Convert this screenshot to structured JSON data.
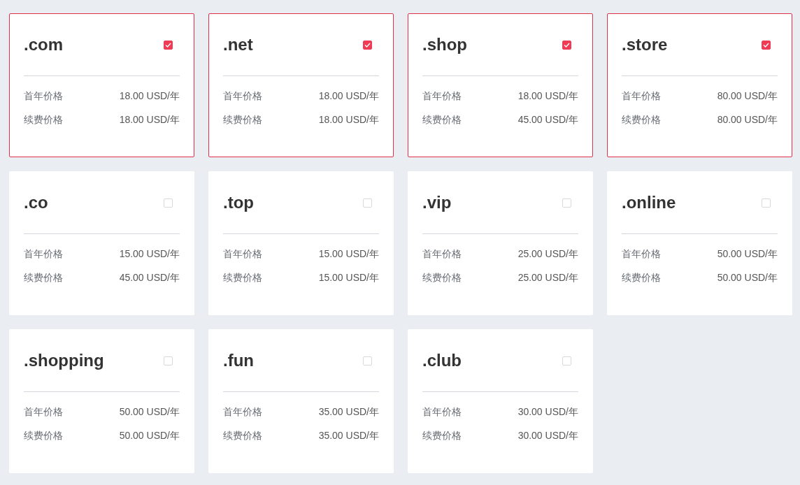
{
  "domains": [
    {
      "name": ".com",
      "selected": true,
      "prices": [
        {
          "label": "首年价格",
          "value": "18.00 USD/年"
        },
        {
          "label": "续费价格",
          "value": "18.00 USD/年"
        }
      ]
    },
    {
      "name": ".net",
      "selected": true,
      "prices": [
        {
          "label": "首年价格",
          "value": "18.00 USD/年"
        },
        {
          "label": "续费价格",
          "value": "18.00 USD/年"
        }
      ]
    },
    {
      "name": ".shop",
      "selected": true,
      "prices": [
        {
          "label": "首年价格",
          "value": "18.00 USD/年"
        },
        {
          "label": "续费价格",
          "value": "45.00 USD/年"
        }
      ]
    },
    {
      "name": ".store",
      "selected": true,
      "prices": [
        {
          "label": "首年价格",
          "value": "80.00 USD/年"
        },
        {
          "label": "续费价格",
          "value": "80.00 USD/年"
        }
      ]
    },
    {
      "name": ".co",
      "selected": false,
      "prices": [
        {
          "label": "首年价格",
          "value": "15.00 USD/年"
        },
        {
          "label": "续费价格",
          "value": "45.00 USD/年"
        }
      ]
    },
    {
      "name": ".top",
      "selected": false,
      "prices": [
        {
          "label": "首年价格",
          "value": "15.00 USD/年"
        },
        {
          "label": "续费价格",
          "value": "15.00 USD/年"
        }
      ]
    },
    {
      "name": ".vip",
      "selected": false,
      "prices": [
        {
          "label": "首年价格",
          "value": "25.00 USD/年"
        },
        {
          "label": "续费价格",
          "value": "25.00 USD/年"
        }
      ]
    },
    {
      "name": ".online",
      "selected": false,
      "prices": [
        {
          "label": "首年价格",
          "value": "50.00 USD/年"
        },
        {
          "label": "续费价格",
          "value": "50.00 USD/年"
        }
      ]
    },
    {
      "name": ".shopping",
      "selected": false,
      "prices": [
        {
          "label": "首年价格",
          "value": "50.00 USD/年"
        },
        {
          "label": "续费价格",
          "value": "50.00 USD/年"
        }
      ]
    },
    {
      "name": ".fun",
      "selected": false,
      "prices": [
        {
          "label": "首年价格",
          "value": "35.00 USD/年"
        },
        {
          "label": "续费价格",
          "value": "35.00 USD/年"
        }
      ]
    },
    {
      "name": ".club",
      "selected": false,
      "prices": [
        {
          "label": "首年价格",
          "value": "30.00 USD/年"
        },
        {
          "label": "续费价格",
          "value": "30.00 USD/年"
        }
      ]
    }
  ]
}
